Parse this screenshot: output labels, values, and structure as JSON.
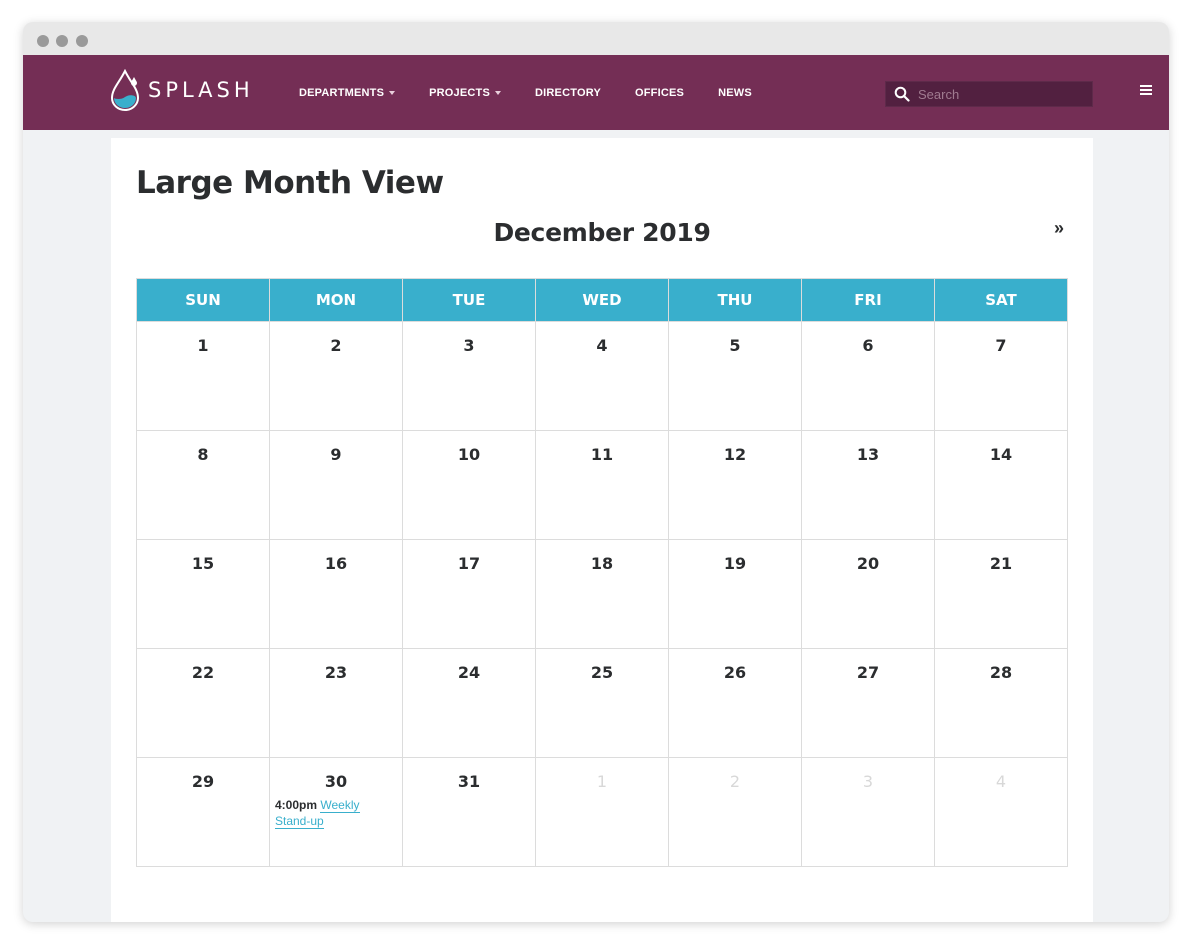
{
  "brand": {
    "name": "SPLASH",
    "logo_icon": "water-drop-icon",
    "color": "#742e55",
    "accent": "#39afcc"
  },
  "nav": {
    "items": [
      {
        "label": "DEPARTMENTS",
        "dropdown": true
      },
      {
        "label": "PROJECTS",
        "dropdown": true
      },
      {
        "label": "DIRECTORY",
        "dropdown": false
      },
      {
        "label": "OFFICES",
        "dropdown": false
      },
      {
        "label": "NEWS",
        "dropdown": false
      }
    ]
  },
  "search": {
    "placeholder": "Search",
    "icon": "search-icon"
  },
  "menu_icon": "hamburger-menu-icon",
  "page": {
    "title": "Large Month View"
  },
  "calendar": {
    "month_label": "December 2019",
    "next_label": "»",
    "weekdays": [
      "SUN",
      "MON",
      "TUE",
      "WED",
      "THU",
      "FRI",
      "SAT"
    ],
    "weeks": [
      [
        {
          "day": "1"
        },
        {
          "day": "2"
        },
        {
          "day": "3"
        },
        {
          "day": "4"
        },
        {
          "day": "5"
        },
        {
          "day": "6"
        },
        {
          "day": "7"
        }
      ],
      [
        {
          "day": "8"
        },
        {
          "day": "9"
        },
        {
          "day": "10"
        },
        {
          "day": "11"
        },
        {
          "day": "12"
        },
        {
          "day": "13"
        },
        {
          "day": "14"
        }
      ],
      [
        {
          "day": "15"
        },
        {
          "day": "16"
        },
        {
          "day": "17"
        },
        {
          "day": "18"
        },
        {
          "day": "19"
        },
        {
          "day": "20"
        },
        {
          "day": "21"
        }
      ],
      [
        {
          "day": "22"
        },
        {
          "day": "23"
        },
        {
          "day": "24"
        },
        {
          "day": "25"
        },
        {
          "day": "26"
        },
        {
          "day": "27"
        },
        {
          "day": "28"
        }
      ],
      [
        {
          "day": "29"
        },
        {
          "day": "30",
          "events": [
            {
              "time": "4:00pm",
              "title": "Weekly Stand-up"
            }
          ]
        },
        {
          "day": "31"
        },
        {
          "day": "1",
          "other": true
        },
        {
          "day": "2",
          "other": true
        },
        {
          "day": "3",
          "other": true
        },
        {
          "day": "4",
          "other": true
        }
      ]
    ]
  }
}
